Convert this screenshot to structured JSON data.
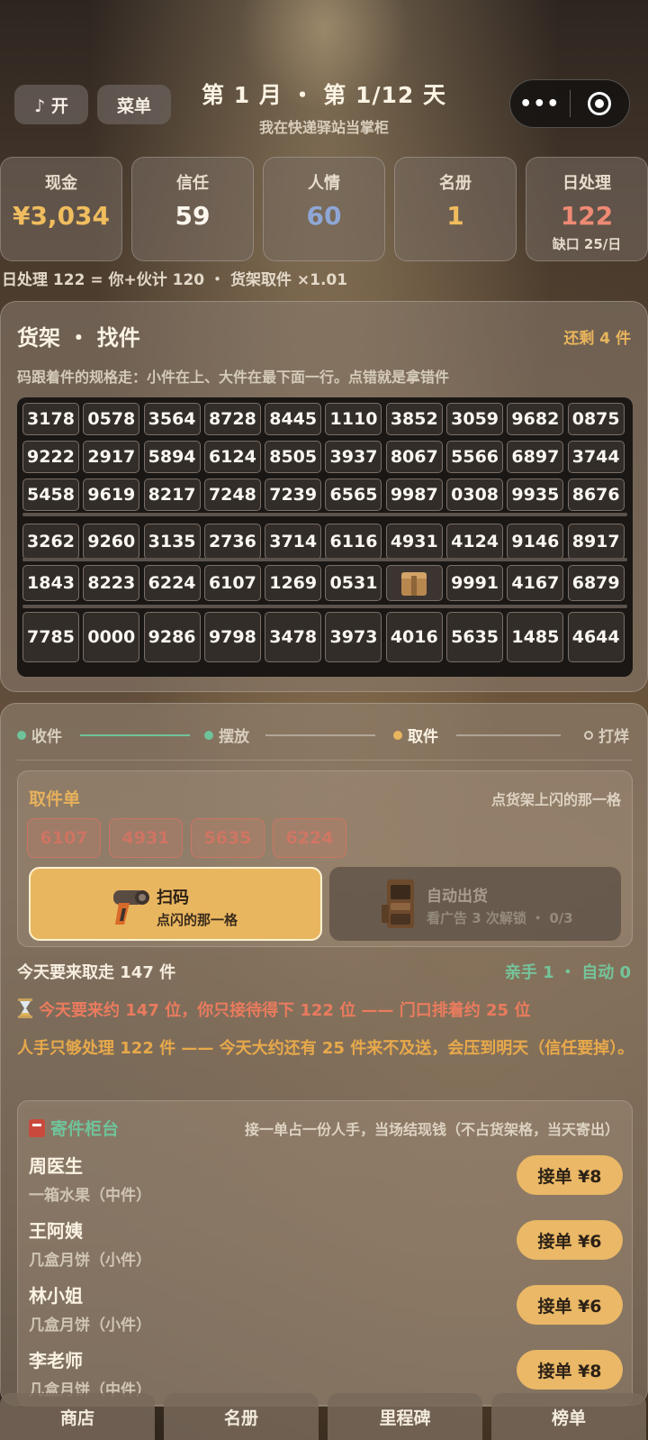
{
  "header": {
    "music_label": "♪ 开",
    "menu_label": "菜单",
    "title": "第 1 月 ・ 第 1/12 天",
    "subtitle": "我在快递驿站当掌柜",
    "capsule_dots": "•••"
  },
  "stats": [
    {
      "label": "现金",
      "value": "¥3,034",
      "color": "#f0bd5e",
      "sub": ""
    },
    {
      "label": "信任",
      "value": "59",
      "color": "#fbf7ee",
      "sub": ""
    },
    {
      "label": "人情",
      "value": "60",
      "color": "#8fa7d6",
      "sub": ""
    },
    {
      "label": "名册",
      "value": "1",
      "color": "#f0bd5e",
      "sub": ""
    },
    {
      "label": "日处理",
      "value": "122",
      "color": "#ee8a74",
      "sub": "缺口 25/日"
    }
  ],
  "formula": "日处理 122 = 你+伙计 120 ・ 货架取件 ×1.01",
  "shelf": {
    "title": "货架 ・ 找件",
    "remaining": "还剩 4 件",
    "hint": "码跟着件的规格走：小件在上、大件在最下面一行。点错就是拿错件",
    "rows": [
      [
        "3178",
        "0578",
        "3564",
        "8728",
        "8445",
        "1110",
        "3852",
        "3059",
        "9682",
        "0875"
      ],
      [
        "9222",
        "2917",
        "5894",
        "6124",
        "8505",
        "3937",
        "8067",
        "5566",
        "6897",
        "3744"
      ],
      [
        "5458",
        "9619",
        "8217",
        "7248",
        "7239",
        "6565",
        "9987",
        "0308",
        "9935",
        "8676"
      ],
      [
        "3262",
        "9260",
        "3135",
        "2736",
        "3714",
        "6116",
        "4931",
        "4124",
        "9146",
        "8917"
      ],
      [
        "1843",
        "8223",
        "6224",
        "6107",
        "1269",
        "0531",
        "",
        "9991",
        "4167",
        "6879"
      ],
      [
        "7785",
        "0000",
        "9286",
        "9798",
        "3478",
        "3973",
        "4016",
        "5635",
        "1485",
        "4644"
      ]
    ],
    "box_cell_icon": "package-icon"
  },
  "steps": [
    {
      "label": "收件",
      "dot_color": "#6fc39a",
      "text_color": "#d9cfbf"
    },
    {
      "label": "摆放",
      "dot_color": "#6fc39a",
      "text_color": "#d9cfbf"
    },
    {
      "label": "取件",
      "dot_color": "#e9b660",
      "text_color": "#fbf3e4"
    },
    {
      "label": "打烊",
      "dot_color": "transparent",
      "text_color": "#d9cfbf"
    }
  ],
  "pickup": {
    "title": "取件单",
    "hint": "点货架上闪的那一格",
    "tags": [
      "6107",
      "4931",
      "5635",
      "6224"
    ],
    "scan_title": "扫码",
    "scan_sub": "点闪的那一格",
    "auto_title": "自动出货",
    "auto_sub": "看广告 3 次解锁 ・ 0/3"
  },
  "today": {
    "text": "今天要来取走 147 件",
    "helpers": "亲手 1 ・ 自动 0",
    "warn1": "今天要来约 147 位，你只接待得下 122 位 —— 门口排着约 25 位",
    "warn1_icon": "hourglass-icon",
    "warn2": "人手只够处理 122 件 —— 今天大约还有 25 件来不及送，会压到明天（信任要掉）。"
  },
  "counter": {
    "title": "寄件柜台",
    "hint": "接一单占一份人手，当场结现钱（不占货架格，当天寄出）",
    "customers": [
      {
        "name": "周医生",
        "item": "一箱水果（中件）",
        "button": "接单 ¥8"
      },
      {
        "name": "王阿姨",
        "item": "几盒月饼（小件）",
        "button": "接单 ¥6"
      },
      {
        "name": "林小姐",
        "item": "几盒月饼（小件）",
        "button": "接单 ¥6"
      },
      {
        "name": "李老师",
        "item": "几盒月饼（中件）",
        "button": "接单 ¥8"
      }
    ]
  },
  "nav": [
    "商店",
    "名册",
    "里程碑",
    "榜单"
  ]
}
